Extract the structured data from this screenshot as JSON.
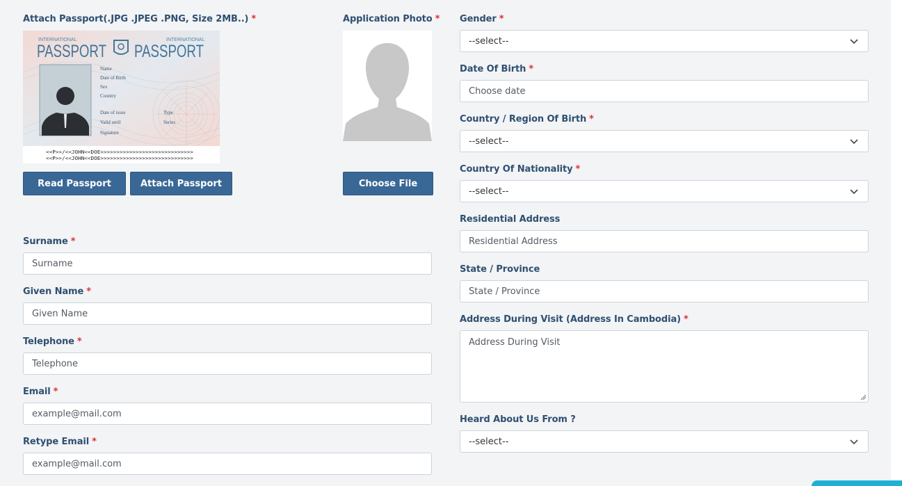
{
  "left": {
    "passport_label": "Attach Passport(.JPG .JPEG .PNG, Size 2MB..)",
    "passport_image": {
      "header_small_left": "INTERNATIONAL",
      "header_small_right": "INTERNATIONAL",
      "header_left": "PASSPORT",
      "header_right": "PASSPORT",
      "field_name": "Name",
      "field_dob": "Date of Birth",
      "field_sex": "Sex",
      "field_country": "Country",
      "field_issue": "Date of issue",
      "field_valid": "Valid until",
      "field_signature": "Signature",
      "field_type": "Type",
      "field_series": "Series",
      "mrz_line1": "<<P>>/<<JOHN<<DOE>>>>>>>>>>>>>>>>>>>>>>>>>>>>>",
      "mrz_line2": "<<P>>/<<JOHN<<DOE>>>>>>>>>>>>>>>>>>>>>>>>>>>>>"
    },
    "read_passport_button": "Read Passport",
    "attach_passport_button": "Attach Passport",
    "photo_label": "Application Photo",
    "choose_file_button": "Choose File",
    "surname": {
      "label": "Surname",
      "placeholder": "Surname"
    },
    "given_name": {
      "label": "Given Name",
      "placeholder": "Given Name"
    },
    "telephone": {
      "label": "Telephone",
      "placeholder": "Telephone"
    },
    "email": {
      "label": "Email",
      "placeholder": "example@mail.com"
    },
    "retype_email": {
      "label": "Retype Email",
      "placeholder": "example@mail.com"
    }
  },
  "right": {
    "gender": {
      "label": "Gender",
      "value": "--select--"
    },
    "dob": {
      "label": "Date Of Birth",
      "placeholder": "Choose date"
    },
    "country_birth": {
      "label": "Country / Region Of Birth",
      "value": "--select--"
    },
    "nationality": {
      "label": "Country Of Nationality",
      "value": "--select--"
    },
    "residential": {
      "label": "Residential Address",
      "placeholder": "Residential Address"
    },
    "state": {
      "label": "State / Province",
      "placeholder": "State / Province"
    },
    "visit_address": {
      "label": "Address During Visit (Address In Cambodia)",
      "placeholder": "Address During Visit"
    },
    "heard": {
      "label": "Heard About Us From ?",
      "value": "--select--"
    }
  },
  "required_mark": "*",
  "icons": {
    "select_arrow": "chevron-down-icon",
    "person": "person-silhouette-icon",
    "passport_emblem": "shield-emblem-icon",
    "resize": "resize-grip-icon"
  },
  "colors": {
    "accent_button": "#3a6896",
    "label": "#2f4f70",
    "required": "#e03131",
    "background": "#f2f4f6"
  }
}
